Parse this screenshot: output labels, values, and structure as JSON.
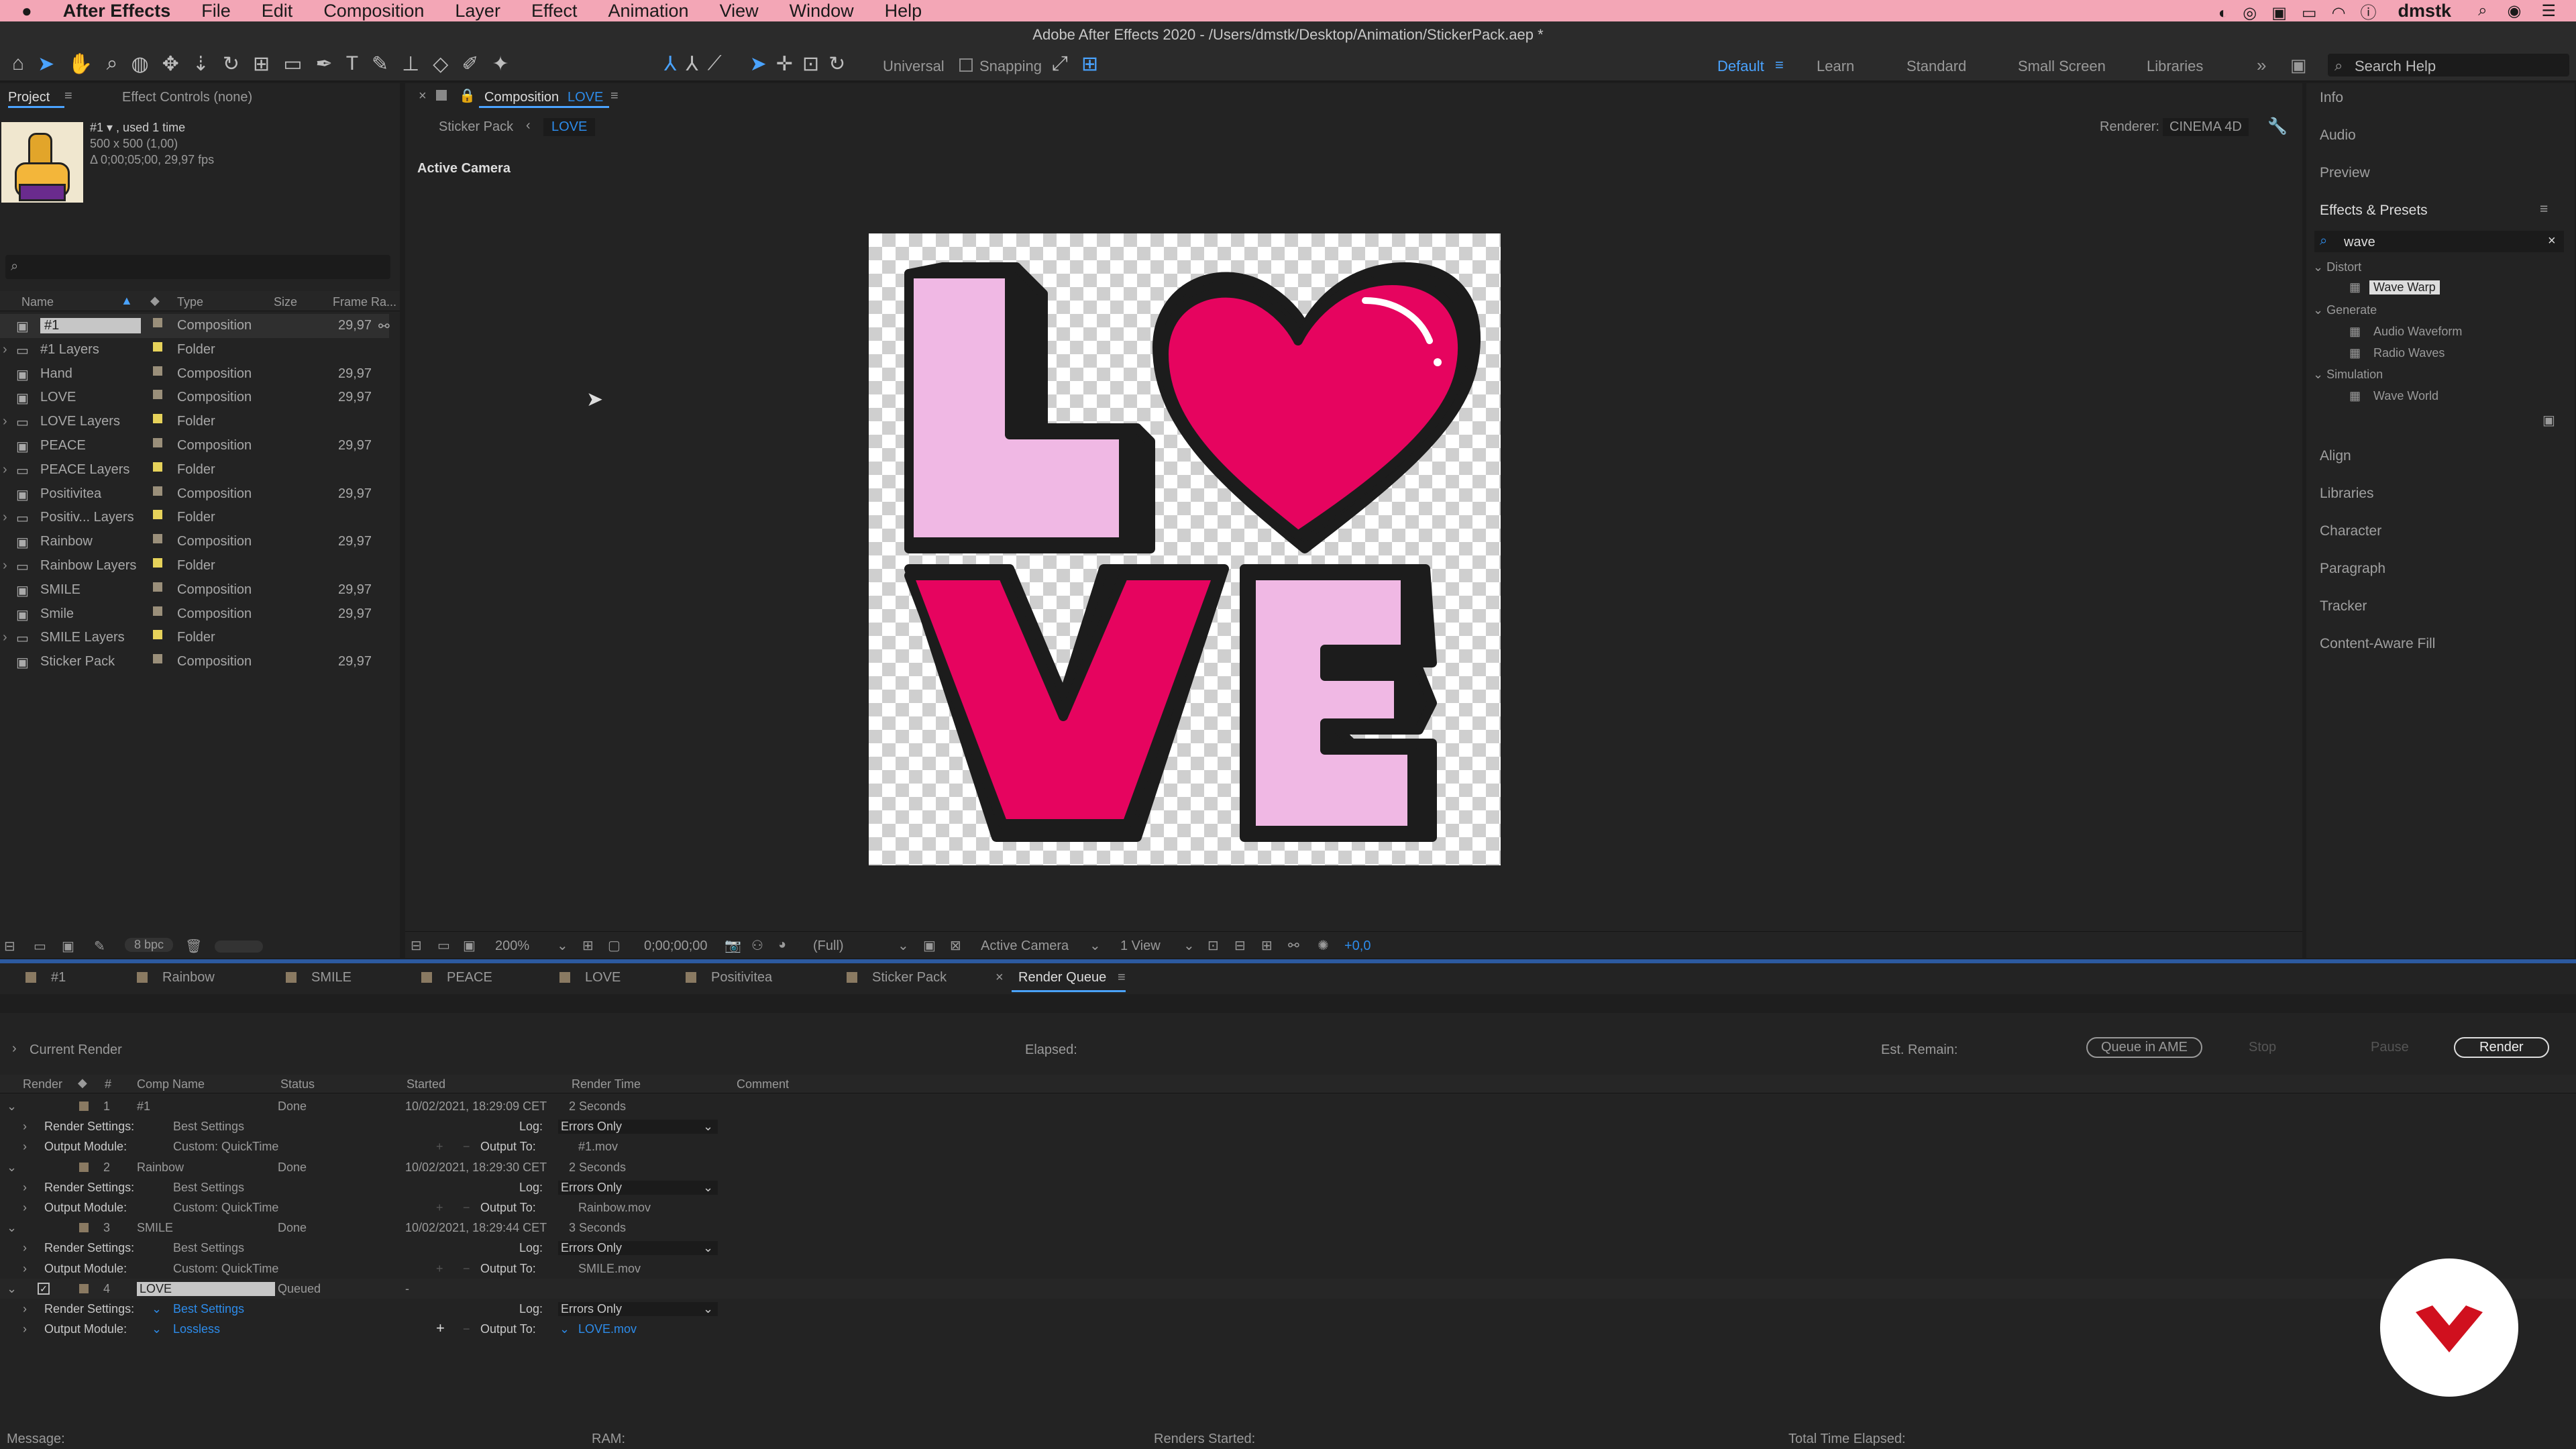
{
  "menubar": {
    "apple": "",
    "app": "After Effects",
    "items": [
      "File",
      "Edit",
      "Composition",
      "Layer",
      "Effect",
      "Animation",
      "View",
      "Window",
      "Help"
    ],
    "user": "dmstk"
  },
  "titlebar": {
    "title": "Adobe After Effects 2020 - /Users/dmstk/Desktop/Animation/StickerPack.aep *"
  },
  "toolbar": {
    "universal": "Universal",
    "snapping": "Snapping",
    "workspaces": [
      "Default",
      "Learn",
      "Standard",
      "Small Screen",
      "Libraries"
    ],
    "search_placeholder": "Search Help"
  },
  "project": {
    "tab": "Project",
    "effect_controls": "Effect Controls (none)",
    "info_name": "#1 ▾ , used 1 time",
    "info_size": "500 x 500 (1,00)",
    "info_dur": "Δ 0;00;05;00, 29,97 fps",
    "columns": [
      "Name",
      "Type",
      "Size",
      "Frame Ra..."
    ],
    "items": [
      {
        "name": "#1",
        "type": "Composition",
        "fps": "29,97",
        "color": "#9a8f7a"
      },
      {
        "name": "#1 Layers",
        "type": "Folder",
        "fps": "",
        "color": "#e6d25a"
      },
      {
        "name": "Hand",
        "type": "Composition",
        "fps": "29,97",
        "color": "#9a8f7a"
      },
      {
        "name": "LOVE",
        "type": "Composition",
        "fps": "29,97",
        "color": "#9a8f7a"
      },
      {
        "name": "LOVE Layers",
        "type": "Folder",
        "fps": "",
        "color": "#e6d25a"
      },
      {
        "name": "PEACE",
        "type": "Composition",
        "fps": "29,97",
        "color": "#9a8f7a"
      },
      {
        "name": "PEACE Layers",
        "type": "Folder",
        "fps": "",
        "color": "#e6d25a"
      },
      {
        "name": "Positivitea",
        "type": "Composition",
        "fps": "29,97",
        "color": "#9a8f7a"
      },
      {
        "name": "Positiv... Layers",
        "type": "Folder",
        "fps": "",
        "color": "#e6d25a"
      },
      {
        "name": "Rainbow",
        "type": "Composition",
        "fps": "29,97",
        "color": "#9a8f7a"
      },
      {
        "name": "Rainbow Layers",
        "type": "Folder",
        "fps": "",
        "color": "#e6d25a"
      },
      {
        "name": "SMILE",
        "type": "Composition",
        "fps": "29,97",
        "color": "#9a8f7a"
      },
      {
        "name": "Smile",
        "type": "Composition",
        "fps": "29,97",
        "color": "#9a8f7a"
      },
      {
        "name": "SMILE Layers",
        "type": "Folder",
        "fps": "",
        "color": "#e6d25a"
      },
      {
        "name": "Sticker Pack",
        "type": "Composition",
        "fps": "29,97",
        "color": "#9a8f7a"
      }
    ],
    "bpc": "8 bpc"
  },
  "comp": {
    "tab_prefix": "Composition",
    "tab_name": "LOVE",
    "crumb_parent": "Sticker Pack",
    "crumb_current": "LOVE",
    "renderer_label": "Renderer:",
    "renderer": "CINEMA 4D",
    "camera_label": "Active Camera",
    "zoom": "200%",
    "timecode": "0;00;00;00",
    "resolution": "(Full)",
    "camera": "Active Camera",
    "views": "1 View",
    "exposure": "+0,0",
    "sticker_colors": {
      "pink_light": "#f0b8e4",
      "pink_hot": "#e6045f",
      "outline": "#1c1c1c"
    }
  },
  "right_panel": {
    "top": [
      "Info",
      "Audio",
      "Preview"
    ],
    "effects_title": "Effects & Presets",
    "search_value": "wave",
    "tree": [
      {
        "group": "Distort",
        "items": [
          "Wave Warp"
        ]
      },
      {
        "group": "Generate",
        "items": [
          "Audio Waveform",
          "Radio Waves"
        ]
      },
      {
        "group": "Simulation",
        "items": [
          "Wave World"
        ]
      }
    ],
    "bottom": [
      "Align",
      "Libraries",
      "Character",
      "Paragraph",
      "Tracker",
      "Content-Aware Fill"
    ]
  },
  "timeline_tabs": [
    "#1",
    "Rainbow",
    "SMILE",
    "PEACE",
    "LOVE",
    "Positivitea",
    "Sticker Pack",
    "Render Queue"
  ],
  "render_queue": {
    "current_render": "Current Render",
    "elapsed": "Elapsed:",
    "est_remain": "Est. Remain:",
    "queue_ame": "Queue in AME",
    "stop": "Stop",
    "pause": "Pause",
    "render": "Render",
    "columns": [
      "Render",
      "#",
      "Comp Name",
      "Status",
      "Started",
      "Render Time",
      "Comment"
    ],
    "items": [
      {
        "num": "1",
        "comp": "#1",
        "status": "Done",
        "started": "10/02/2021, 18:29:09 CET",
        "time": "2 Seconds",
        "settings": "Best Settings",
        "module": "Custom: QuickTime",
        "log": "Errors Only",
        "output": "#1.mov"
      },
      {
        "num": "2",
        "comp": "Rainbow",
        "status": "Done",
        "started": "10/02/2021, 18:29:30 CET",
        "time": "2 Seconds",
        "settings": "Best Settings",
        "module": "Custom: QuickTime",
        "log": "Errors Only",
        "output": "Rainbow.mov"
      },
      {
        "num": "3",
        "comp": "SMILE",
        "status": "Done",
        "started": "10/02/2021, 18:29:44 CET",
        "time": "3 Seconds",
        "settings": "Best Settings",
        "module": "Custom: QuickTime",
        "log": "Errors Only",
        "output": "SMILE.mov"
      },
      {
        "num": "4",
        "comp": "LOVE",
        "status": "Queued",
        "started": "-",
        "time": "",
        "settings": "Best Settings",
        "module": "Lossless",
        "log": "Errors Only",
        "output": "LOVE.mov"
      }
    ],
    "labels": {
      "render_settings": "Render Settings:",
      "output_module": "Output Module:",
      "log": "Log:",
      "output_to": "Output To:"
    }
  },
  "statusbar": {
    "message": "Message:",
    "ram": "RAM:",
    "renders_started": "Renders Started:",
    "total_time": "Total Time Elapsed:"
  }
}
